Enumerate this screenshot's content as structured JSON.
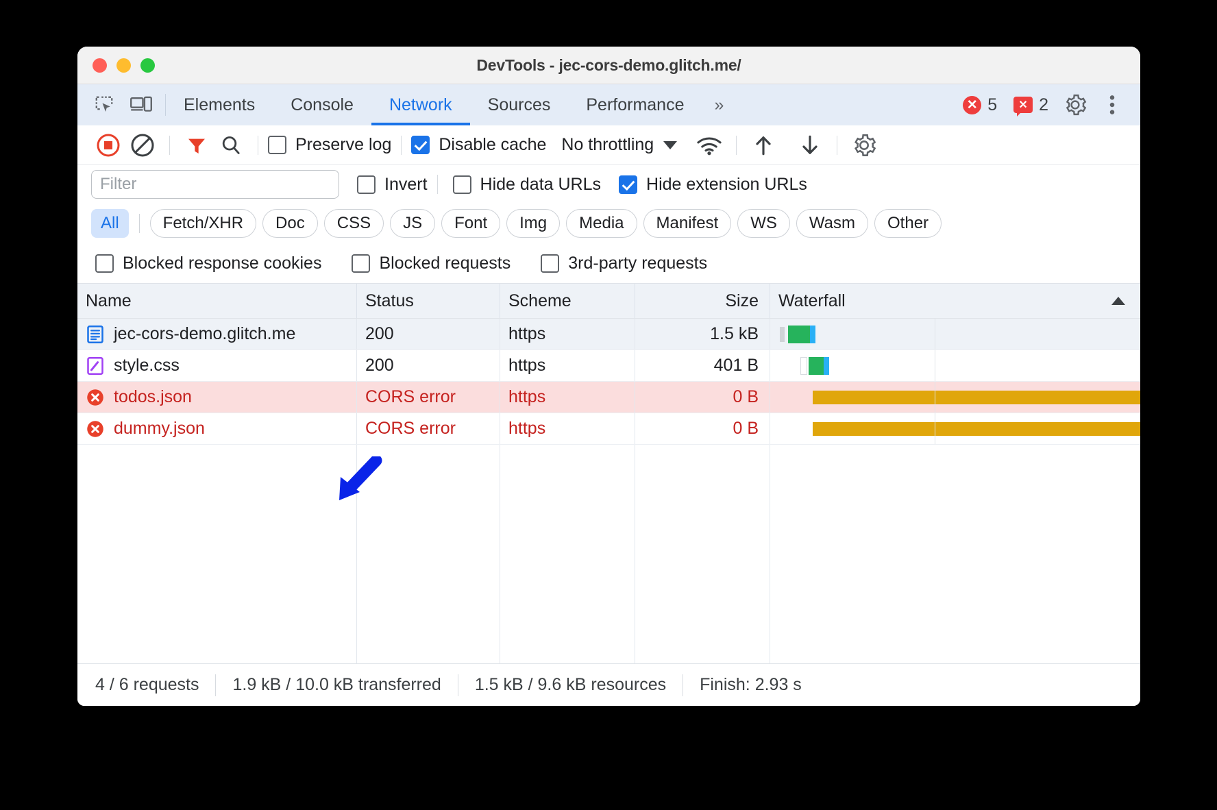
{
  "window": {
    "title": "DevTools - jec-cors-demo.glitch.me/",
    "traffic_lights": [
      "close",
      "minimize",
      "zoom"
    ]
  },
  "tabstrip": {
    "left_icons": [
      {
        "name": "inspect-element-icon"
      },
      {
        "name": "device-toolbar-icon"
      }
    ],
    "tabs": [
      {
        "label": "Elements",
        "active": false
      },
      {
        "label": "Console",
        "active": false
      },
      {
        "label": "Network",
        "active": true
      },
      {
        "label": "Sources",
        "active": false
      },
      {
        "label": "Performance",
        "active": false
      }
    ],
    "more_tabs_label": "»",
    "error_count": "5",
    "warning_count": "2",
    "settings_icon": "gear-icon",
    "more_icon": "kebab-menu-icon"
  },
  "toolbar": {
    "record_icon": "record-stop-icon",
    "clear_icon": "clear-icon",
    "filter_icon": "filter-funnel-icon",
    "search_icon": "search-icon",
    "preserve_log": {
      "label": "Preserve log",
      "checked": false
    },
    "disable_cache": {
      "label": "Disable cache",
      "checked": true
    },
    "throttling": {
      "value": "No throttling"
    },
    "wifi_icon": "network-conditions-icon",
    "import_icon": "upload-arrow-icon",
    "export_icon": "download-arrow-icon",
    "settings_icon": "gear-icon"
  },
  "filter_row": {
    "filter_placeholder": "Filter",
    "filter_value": "",
    "invert": {
      "label": "Invert",
      "checked": false
    },
    "hide_data_urls": {
      "label": "Hide data URLs",
      "checked": false
    },
    "hide_extension_urls": {
      "label": "Hide extension URLs",
      "checked": true
    }
  },
  "type_filters": [
    {
      "label": "All",
      "selected": true
    },
    {
      "label": "Fetch/XHR",
      "selected": false
    },
    {
      "label": "Doc",
      "selected": false
    },
    {
      "label": "CSS",
      "selected": false
    },
    {
      "label": "JS",
      "selected": false
    },
    {
      "label": "Font",
      "selected": false
    },
    {
      "label": "Img",
      "selected": false
    },
    {
      "label": "Media",
      "selected": false
    },
    {
      "label": "Manifest",
      "selected": false
    },
    {
      "label": "WS",
      "selected": false
    },
    {
      "label": "Wasm",
      "selected": false
    },
    {
      "label": "Other",
      "selected": false
    }
  ],
  "block_filters": [
    {
      "label": "Blocked response cookies",
      "checked": false
    },
    {
      "label": "Blocked requests",
      "checked": false
    },
    {
      "label": "3rd-party requests",
      "checked": false
    }
  ],
  "table": {
    "columns": [
      {
        "label": "Name"
      },
      {
        "label": "Status"
      },
      {
        "label": "Scheme"
      },
      {
        "label": "Size"
      },
      {
        "label": "Waterfall",
        "sorted": "asc"
      }
    ],
    "rows": [
      {
        "icon": "document-icon",
        "name": "jec-cors-demo.glitch.me",
        "status": "200",
        "scheme": "https",
        "size": "1.5 kB",
        "error": false
      },
      {
        "icon": "stylesheet-icon",
        "name": "style.css",
        "status": "200",
        "scheme": "https",
        "size": "401 B",
        "error": false
      },
      {
        "icon": "error-circle-icon",
        "name": "todos.json",
        "status": "CORS error",
        "scheme": "https",
        "size": "0 B",
        "error": true
      },
      {
        "icon": "error-circle-icon",
        "name": "dummy.json",
        "status": "CORS error",
        "scheme": "https",
        "size": "0 B",
        "error": true
      }
    ]
  },
  "statusbar": {
    "requests": "4 / 6 requests",
    "transferred": "1.9 kB / 10.0 kB transferred",
    "resources": "1.5 kB / 9.6 kB resources",
    "finish": "Finish: 2.93 s"
  },
  "annotation": {
    "type": "arrow",
    "color": "#0a24e8",
    "points_to": "todos.json"
  },
  "colors": {
    "accent": "#1a73e8",
    "error": "#c5221f",
    "error_row_bg": "#fbdddd",
    "waterfall_success": "#26b35c",
    "waterfall_error": "#e0a60b",
    "annotation": "#0a24e8"
  }
}
